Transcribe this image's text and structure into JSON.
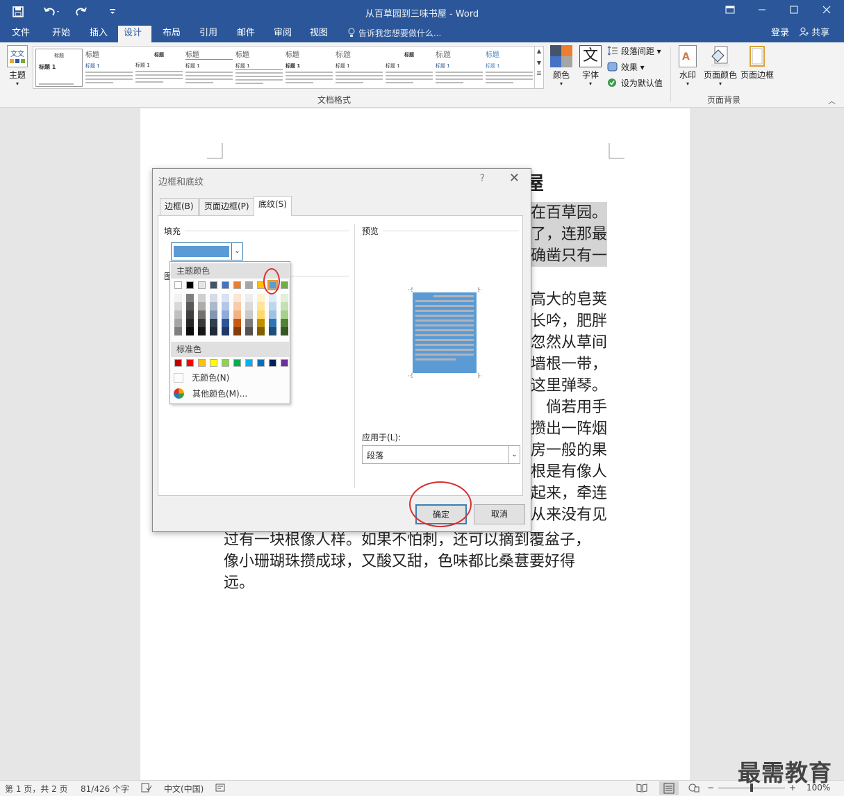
{
  "window": {
    "title": "从百草园到三味书屋 - Word",
    "quick_access": [
      "save-icon",
      "undo-icon",
      "redo-icon",
      "customize-icon"
    ]
  },
  "menu": {
    "items": [
      "文件",
      "开始",
      "插入",
      "设计",
      "布局",
      "引用",
      "邮件",
      "审阅",
      "视图"
    ],
    "active": "设计",
    "tell_me": "告诉我您想要做什么...",
    "login": "登录",
    "share": "共享"
  },
  "ribbon": {
    "theme_label": "主题",
    "gallery_items": [
      {
        "title": "标题",
        "h1": "标题 1"
      },
      {
        "title": "标题",
        "h1": "标题 1"
      },
      {
        "title": "标题",
        "h1": "标题 1"
      },
      {
        "title": "标题",
        "h1": "标题 1"
      },
      {
        "title": "标题",
        "h1": "标题 1"
      },
      {
        "title": "标题",
        "h1": "标题 1"
      },
      {
        "title": "标题",
        "h1": "标题 1"
      },
      {
        "title": "标题",
        "h1": "标题 1"
      },
      {
        "title": "标题",
        "h1": "标题 1"
      },
      {
        "title": "标题",
        "h1": "标题 1"
      }
    ],
    "colors_label": "颜色",
    "fonts_label": "字体",
    "fonts_glyph": "文",
    "paragraph_spacing": "段落间距",
    "effects": "效果",
    "set_default": "设为默认值",
    "group_doc_format": "文档格式",
    "watermark": "水印",
    "page_color": "页面颜色",
    "page_border": "页面边框",
    "group_page_bg": "页面背景"
  },
  "document": {
    "title_fragment": "屋",
    "left_lines": [
      {
        "text": "过有一块根像人样。如果不怕刺，还可以摘到覆盆子，"
      },
      {
        "text": "像小珊瑚珠攒成球，又酸又甜，色味都比桑葚要好得"
      },
      {
        "text": "远。"
      }
    ],
    "right_lines": [
      {
        "text": "在百草园。",
        "shaded": true
      },
      {
        "text": "了，连那最",
        "shaded": true
      },
      {
        "text": "确凿只有一",
        "shaded": true
      },
      {
        "text": "高大的皂荚",
        "shaded": false
      },
      {
        "text": "长吟，肥胖",
        "shaded": false
      },
      {
        "text": "忽然从草间",
        "shaded": false
      },
      {
        "text": "墙根一带，",
        "shaded": false
      },
      {
        "text": "这里弹琴。",
        "shaded": false
      },
      {
        "text": "倘若用手",
        "shaded": false
      },
      {
        "text": "攒出一阵烟",
        "shaded": false
      },
      {
        "text": "房一般的果",
        "shaded": false
      },
      {
        "text": "根是有像人",
        "shaded": false
      },
      {
        "text": "起来，牵连",
        "shaded": false
      },
      {
        "text": "从来没有见",
        "shaded": false
      }
    ]
  },
  "dialog": {
    "title": "边框和底纹",
    "help": "?",
    "tabs": [
      "边框(B)",
      "页面边框(P)",
      "底纹(S)"
    ],
    "active_tab": "底纹(S)",
    "fill_label": "填充",
    "pattern_label": "图",
    "preview_label": "预览",
    "apply_to_label": "应用于(L):",
    "apply_to_value": "段落",
    "ok": "确定",
    "cancel": "取消",
    "selected_color": "#5b9bd5"
  },
  "palette": {
    "theme_header": "主题颜色",
    "standard_header": "标准色",
    "no_color": "无颜色(N)",
    "more_colors": "其他颜色(M)...",
    "theme_colors": [
      "#ffffff",
      "#000000",
      "#e7e6e6",
      "#44546a",
      "#4472c4",
      "#ed7d31",
      "#a5a5a5",
      "#ffc000",
      "#5b9bd5",
      "#70ad47"
    ],
    "shades": [
      [
        "#f2f2f2",
        "#7f7f7f",
        "#d0cece",
        "#d6dce4",
        "#d9e2f3",
        "#fbe5d5",
        "#ededed",
        "#fff2cc",
        "#deebf6",
        "#e2efd9"
      ],
      [
        "#d8d8d8",
        "#595959",
        "#aeabab",
        "#adb9ca",
        "#b4c6e7",
        "#f7cbac",
        "#dbdbdb",
        "#fee599",
        "#bdd7ee",
        "#c5e0b3"
      ],
      [
        "#bfbfbf",
        "#3f3f3f",
        "#757070",
        "#8496b0",
        "#8eaadb",
        "#f4b183",
        "#c9c9c9",
        "#ffd965",
        "#9cc3e5",
        "#a8d08d"
      ],
      [
        "#a5a5a5",
        "#262626",
        "#3a3838",
        "#323f4f",
        "#2f5496",
        "#c55a11",
        "#7b7b7b",
        "#bf8f00",
        "#2e75b5",
        "#538135"
      ],
      [
        "#7f7f7f",
        "#0c0c0c",
        "#171616",
        "#222a35",
        "#1f3864",
        "#833c0b",
        "#525252",
        "#7f6000",
        "#1e4e79",
        "#375623"
      ]
    ],
    "standard_colors": [
      "#c00000",
      "#ff0000",
      "#ffc000",
      "#ffff00",
      "#92d050",
      "#00b050",
      "#00b0f0",
      "#0070c0",
      "#002060",
      "#7030a0"
    ]
  },
  "status": {
    "page": "第 1 页，共 2 页",
    "words": "81/426 个字",
    "language": "中文(中国)",
    "zoom": "100%"
  },
  "watermark_text": "最需教育"
}
